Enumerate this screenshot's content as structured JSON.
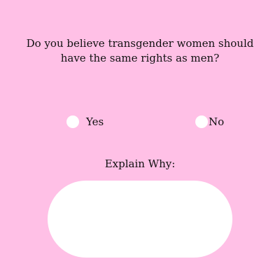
{
  "survey": {
    "question": "Do you believe transgender women should\nhave the same rights as men?",
    "options": [
      {
        "label": "Yes",
        "selected": false
      },
      {
        "label": "No",
        "selected": false
      }
    ],
    "explain_label": "Explain Why:",
    "explain_value": ""
  },
  "colors": {
    "background": "#ffc0e6",
    "radio_fill": "#ffffff",
    "textbox_fill": "#ffffff",
    "text": "#111111"
  }
}
